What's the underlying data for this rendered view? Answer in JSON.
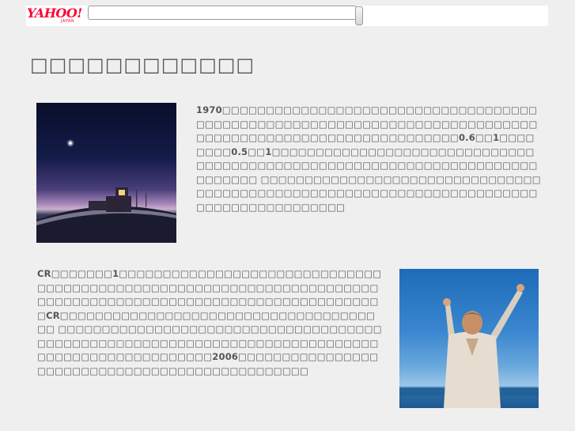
{
  "header": {
    "logo_text": "YAHOO!",
    "logo_subtext": "JAPAN",
    "search_placeholder": "",
    "search_button_label": ""
  },
  "page": {
    "title": "□□□□□□□□□□□□"
  },
  "articles": [
    {
      "image_icon": "night-sky-fisheye-photo",
      "text": "1970□□□□□□□□□□□□□□□□□□□□□□□□□□□□□□□□□□□□□□□□□□□□□□□□□□□□□□□□□□□□□□□□□□□□□□□□□□□□□□□□□□□□□□□□□□□□□□□□□□□□□□□□□0.6□□1□□□□□□□□0.5□□1□□□□□□□□□□□□□□□□□□□□□□□□□□□□□□□□□□□□□□□□□□□□□□□□□□□□□□□□□□□□□□□□□□□□□□□□□□□□ □□□□□□□□□□□□□□□□□□□□□□□□□□□□□□□□□□□□□□□□□□□□□□□□□□□□□□□□□□□□□□□□□□□□□□□□□□□□□□□□□□□□□□□□"
    },
    {
      "image_icon": "man-raising-arms-photo",
      "text": "CR□□□□□□□1□□□□□□□□□□□□□□□□□□□□□□□□□□□□□□□□□□□□□□□□□□□□□□□□□□□□□□□□□□□□□□□□□□□□□□□□□□□□□□□□□□□□□□□□□□□□□□□□□□□□□□□□□□□□□CR□□□□□□□□□□□□□□□□□□□□□□□□□□□□□□□□□□□□□□ □□□□□□□□□□□□□□□□□□□□□□□□□□□□□□□□□□□□□□□□□□□□□□□□□□□□□□□□□□□□□□□□□□□□□□□□□□□□□□□□□□□□□□□□□□□□□□□□2006□□□□□□□□□□□□□□□□□□□□□□□□□□□□□□□□□□□□□□□□□□□□□□□"
    }
  ],
  "colors": {
    "background": "#efefef",
    "text": "#555555",
    "logo": "#ff0033"
  }
}
